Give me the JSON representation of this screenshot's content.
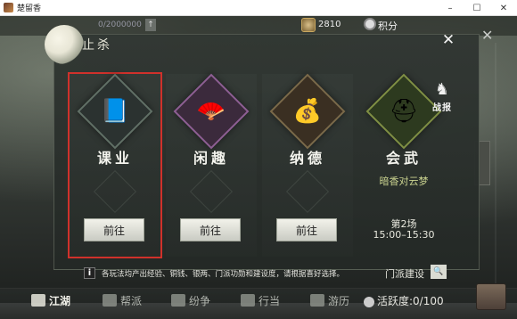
{
  "window": {
    "title": "楚留香",
    "minimize": "–",
    "maximize": "☐",
    "close": "✕"
  },
  "topbar": {
    "xp": "0/2000000",
    "up_arrow": "↑",
    "coins": "2810",
    "points_label": "积分",
    "close": "✕"
  },
  "panel": {
    "title": "止杀",
    "close": "✕"
  },
  "cards": [
    {
      "name": "课业",
      "button": "前往",
      "icon": "scroll-book-icon",
      "selected": true
    },
    {
      "name": "闲趣",
      "button": "前往",
      "icon": "folding-fan-icon",
      "selected": false
    },
    {
      "name": "纳德",
      "button": "前往",
      "icon": "money-bag-icon",
      "selected": false
    },
    {
      "name": "会武",
      "icon": "helmet-icon",
      "selected": false,
      "team": "暗香对云梦",
      "round": "第2场",
      "time": "15:00–15:30"
    }
  ],
  "battle_report": {
    "glyph": "♞",
    "label": "战报"
  },
  "info": {
    "i": "i",
    "text": "各玩法均产出经验、铜钱、银两、门派功勋和建设度，请根据喜好选择。",
    "build_label": "门派建设",
    "search": "🔍"
  },
  "bottom_nav": [
    {
      "label": "江湖",
      "active": true
    },
    {
      "label": "帮派",
      "active": false
    },
    {
      "label": "纷争",
      "active": false
    },
    {
      "label": "行当",
      "active": false
    },
    {
      "label": "游历",
      "active": false
    }
  ],
  "activity": {
    "label": "活跃度:0/100"
  },
  "colors": {
    "selection_border": "#d0312b",
    "team_text": "#c9d28f"
  }
}
